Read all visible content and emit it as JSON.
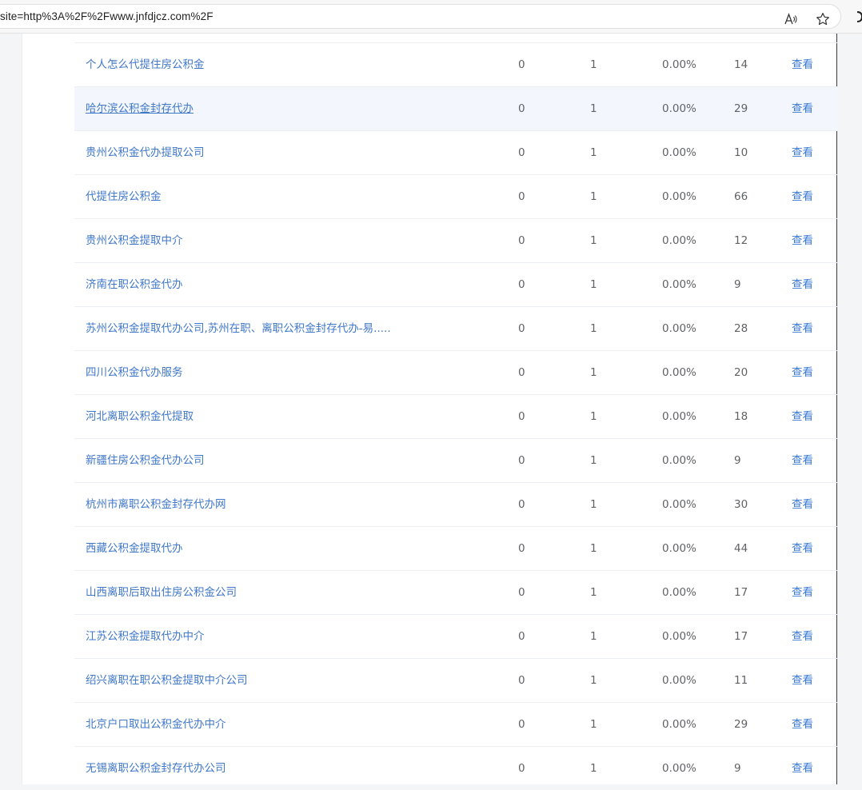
{
  "browser": {
    "url": "site=http%3A%2F%2Fwww.jnfdjcz.com%2F",
    "read_aloud_icon": "read-aloud-icon",
    "favorite_icon": "star-icon"
  },
  "table": {
    "rows": [
      {
        "keyword": "个人怎么代提住房公积金",
        "a": "0",
        "b": "1",
        "rate": "0.00%",
        "count": "14",
        "action": "查看"
      },
      {
        "keyword": "哈尔滨公积金封存代办",
        "a": "0",
        "b": "1",
        "rate": "0.00%",
        "count": "29",
        "action": "查看"
      },
      {
        "keyword": "贵州公积金代办提取公司",
        "a": "0",
        "b": "1",
        "rate": "0.00%",
        "count": "10",
        "action": "查看"
      },
      {
        "keyword": "代提住房公积金",
        "a": "0",
        "b": "1",
        "rate": "0.00%",
        "count": "66",
        "action": "查看"
      },
      {
        "keyword": "贵州公积金提取中介",
        "a": "0",
        "b": "1",
        "rate": "0.00%",
        "count": "12",
        "action": "查看"
      },
      {
        "keyword": "济南在职公积金代办",
        "a": "0",
        "b": "1",
        "rate": "0.00%",
        "count": "9",
        "action": "查看"
      },
      {
        "keyword": "苏州公积金提取代办公司,苏州在职、离职公积金封存代办-易.....",
        "a": "0",
        "b": "1",
        "rate": "0.00%",
        "count": "28",
        "action": "查看"
      },
      {
        "keyword": "四川公积金代办服务",
        "a": "0",
        "b": "1",
        "rate": "0.00%",
        "count": "20",
        "action": "查看"
      },
      {
        "keyword": "河北离职公积金代提取",
        "a": "0",
        "b": "1",
        "rate": "0.00%",
        "count": "18",
        "action": "查看"
      },
      {
        "keyword": "新疆住房公积金代办公司",
        "a": "0",
        "b": "1",
        "rate": "0.00%",
        "count": "9",
        "action": "查看"
      },
      {
        "keyword": "杭州市离职公积金封存代办网",
        "a": "0",
        "b": "1",
        "rate": "0.00%",
        "count": "30",
        "action": "查看"
      },
      {
        "keyword": "西藏公积金提取代办",
        "a": "0",
        "b": "1",
        "rate": "0.00%",
        "count": "44",
        "action": "查看"
      },
      {
        "keyword": "山西离职后取出住房公积金公司",
        "a": "0",
        "b": "1",
        "rate": "0.00%",
        "count": "17",
        "action": "查看"
      },
      {
        "keyword": "江苏公积金提取代办中介",
        "a": "0",
        "b": "1",
        "rate": "0.00%",
        "count": "17",
        "action": "查看"
      },
      {
        "keyword": "绍兴离职在职公积金提取中介公司",
        "a": "0",
        "b": "1",
        "rate": "0.00%",
        "count": "11",
        "action": "查看"
      },
      {
        "keyword": "北京户口取出公积金代办中介",
        "a": "0",
        "b": "1",
        "rate": "0.00%",
        "count": "29",
        "action": "查看"
      },
      {
        "keyword": "无锡离职公积金封存代办公司",
        "a": "0",
        "b": "1",
        "rate": "0.00%",
        "count": "9",
        "action": "查看"
      }
    ]
  }
}
